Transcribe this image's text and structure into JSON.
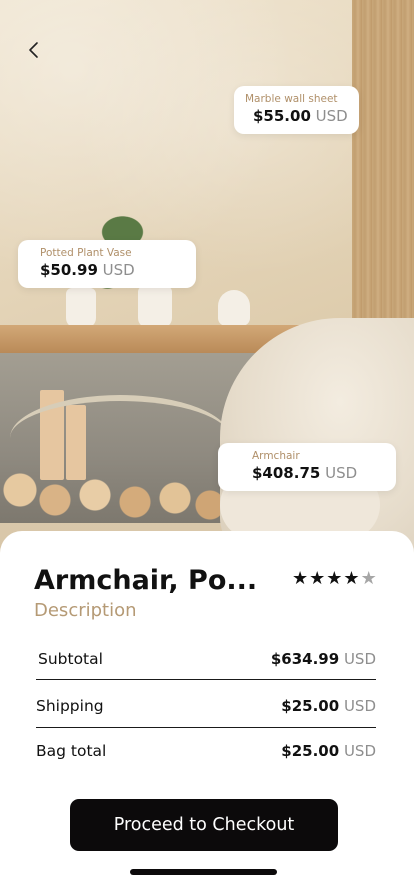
{
  "hero": {
    "tags": [
      {
        "name": "Marble wall sheet",
        "amount": "$55.00",
        "currency": "USD"
      },
      {
        "name": "Potted Plant Vase",
        "amount": "$50.99",
        "currency": "USD"
      },
      {
        "name": "Armchair",
        "amount": "$408.75",
        "currency": "USD"
      }
    ]
  },
  "summary": {
    "title": "Armchair, Po...",
    "rating": 4,
    "rating_max": 5,
    "description_label": "Description",
    "rows": [
      {
        "label": "Subtotal",
        "amount": "$634.99",
        "currency": "USD"
      },
      {
        "label": "Shipping",
        "amount": "$25.00",
        "currency": "USD"
      },
      {
        "label": "Bag total",
        "amount": "$25.00",
        "currency": "USD"
      }
    ],
    "checkout_label": "Proceed to Checkout"
  },
  "icons": {
    "back": "chevron-left-icon",
    "star": "star-icon"
  },
  "colors": {
    "accent": "#b59a75",
    "button": "#0c0a0b",
    "currency": "#8e8e8e"
  }
}
